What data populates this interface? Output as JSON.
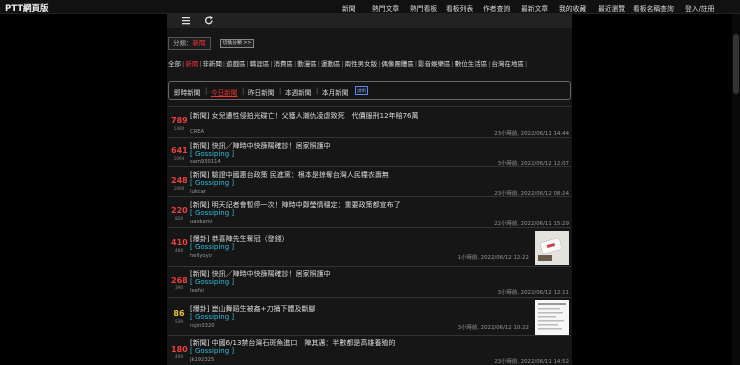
{
  "header": {
    "logo": "PTT網頁版",
    "nav": [
      "新聞",
      "熱門文章",
      "熱門看板",
      "看板列表",
      "作者查詢",
      "最新文章",
      "我的收藏",
      "最近瀏覽",
      "看板名稱查詢",
      "登入/註冊"
    ]
  },
  "toolbar": {
    "menu_icon": "menu-icon",
    "refresh_icon": "refresh-icon"
  },
  "category": {
    "label": "分類：",
    "value": "新聞",
    "switch_button": "切換分類 >>"
  },
  "boards": [
    "全部",
    "新聞",
    "非新聞",
    "遊戲區",
    "職涯區",
    "消費區",
    "動漫區",
    "運動區",
    "兩性男女版",
    "偶像團體區",
    "影音娛樂區",
    "數位生活區",
    "台灣在地區"
  ],
  "tabs": {
    "items": [
      "即時新聞",
      "今日新聞",
      "昨日新聞",
      "本週新聞",
      "本月新聞"
    ],
    "active": "今日新聞",
    "note": "說明"
  },
  "articles": [
    {
      "push": "789",
      "push_color": "#e84040",
      "sub": "1480",
      "title": "[新聞] 女兒遭性侵拍光碟亡！父獲人潮仇凌虐致死　代價服刑12年賠76萬",
      "board": "[ Gossiping ]",
      "author": "CREA",
      "time": "23小時前, 2022/06/11 14:44"
    },
    {
      "push": "641",
      "push_color": "#e84040",
      "sub": "1094",
      "title": "[新聞] 快訊／陣時中快篩陽確診！居家照護中",
      "board": "[ Gossiping ]",
      "author": "sam930114",
      "time": "3小時前, 2022/06/12 12:07"
    },
    {
      "push": "248",
      "push_color": "#e84040",
      "sub": "1000",
      "title": "[新聞] 驗證中國惠台政策 民進黨：根本是掠奪台灣人民糧衣壽無",
      "board": "[ Gossiping ]",
      "author": "lukcar",
      "time": "23小時前, 2022/06/12 08:24"
    },
    {
      "push": "220",
      "push_color": "#e84040",
      "sub": "826",
      "title": "[新聞] 明天記者會暫停一次！陣時中鄭瑩情穩定：重要政策都宣布了",
      "board": "[ Gossiping ]",
      "author": "uaokami",
      "time": "22小時前, 2022/06/11 15:29"
    },
    {
      "push": "410",
      "push_color": "#e84040",
      "sub": "468",
      "title": "[爆卦] 恭喜陣先生奪冠（發錢）",
      "board": "[ Gossiping ]",
      "author": "hellyoyo",
      "time": "1小時前, 2022/06/12 12:22"
    },
    {
      "push": "268",
      "push_color": "#e84040",
      "sub": "390",
      "title": "[新聞] 快訊／陣時中快篩陽確診！居家照護中",
      "board": "[ Gossiping ]",
      "author": "leefsi",
      "time": "3小時前, 2022/06/12 12:11"
    },
    {
      "push": "86",
      "push_color": "#e6c43c",
      "sub": "539",
      "title": "[爆卦] 崑山舞蹈生被姦+刀捅下體及斷腳",
      "board": "[ Gossiping ]",
      "author": "rojin0320",
      "time": "3小時前, 2022/06/12 10:22"
    },
    {
      "push": "180",
      "push_color": "#e84040",
      "sub": "469",
      "title": "[新聞] 中國6/13禁台灣石斑魚進口　陣其邁：半數都是高雄養殖的",
      "board": "[ Gossiping ]",
      "author": "jk192325",
      "time": "23小時前, 2022/06/11 14:52"
    }
  ],
  "colors": {
    "accent": "#e33333",
    "board": "#33bbdd",
    "background": "#000000"
  }
}
